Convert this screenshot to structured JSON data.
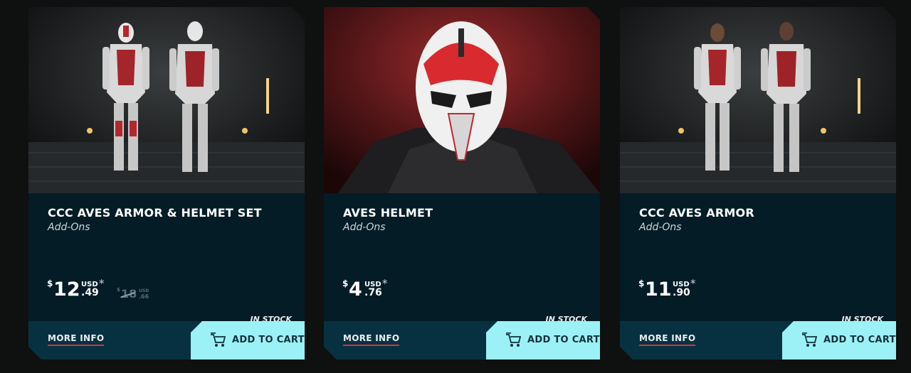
{
  "products": [
    {
      "title": "CCC AVES ARMOR & HELMET SET",
      "category": "Add-Ons",
      "price": {
        "currency": "$",
        "int": "12",
        "usd": "USD",
        "star": "*",
        "dec": ".49"
      },
      "old_price": {
        "currency": "$",
        "int": "18",
        "usd": "USD",
        "dec": ".66"
      },
      "stock": "IN STOCK",
      "more_info": "MORE INFO",
      "add_to_cart": "ADD TO CART"
    },
    {
      "title": "AVES HELMET",
      "category": "Add-Ons",
      "price": {
        "currency": "$",
        "int": "4",
        "usd": "USD",
        "star": "*",
        "dec": ".76"
      },
      "stock": "IN STOCK",
      "more_info": "MORE INFO",
      "add_to_cart": "ADD TO CART"
    },
    {
      "title": "CCC AVES ARMOR",
      "category": "Add-Ons",
      "price": {
        "currency": "$",
        "int": "11",
        "usd": "USD",
        "star": "*",
        "dec": ".90"
      },
      "stock": "IN STOCK",
      "more_info": "MORE INFO",
      "add_to_cart": "ADD TO CART"
    }
  ],
  "colors": {
    "card_bg": "#031c26",
    "footer_bg": "#073140",
    "cart_button": "#9cf1f6",
    "underline_accent": "#d5343b",
    "armor_red": "#c0272d"
  },
  "icons": {
    "cart": "shopping-cart-icon"
  }
}
